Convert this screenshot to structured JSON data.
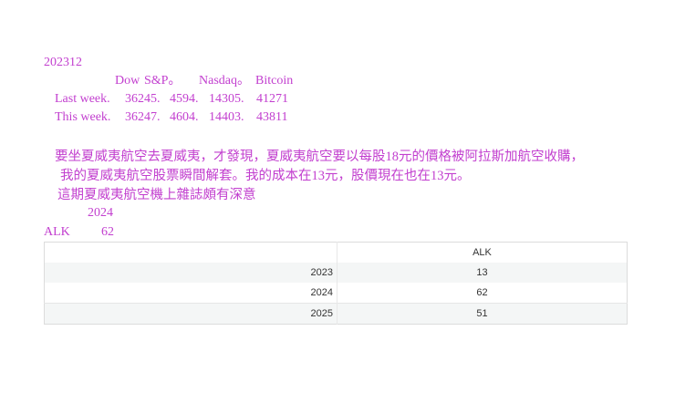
{
  "heading": "202312",
  "market": {
    "columns": [
      "Dow",
      "S&P。",
      "Nasdaq。",
      "Bitcoin"
    ],
    "rows": [
      {
        "label": "Last week.",
        "values": [
          "36245.",
          "4594.",
          "14305.",
          "41271"
        ]
      },
      {
        "label": "This week.",
        "values": [
          "36247.",
          "4604.",
          "14403.",
          "43811"
        ]
      }
    ]
  },
  "note": {
    "line1": "要坐夏威夷航空去夏威夷，才發現，夏威夷航空要以每股18元的價格被阿拉斯加航空收購，",
    "line2": "我的夏威夷航空股票瞬間解套。我的成本在13元，股價現在也在13元。",
    "line3": "這期夏威夷航空機上雜誌頗有深意"
  },
  "summary": {
    "year": "2024",
    "ticker": "ALK",
    "value": "62"
  },
  "table": {
    "header": [
      "",
      "ALK"
    ],
    "rows": [
      {
        "year": "2023",
        "value": "13"
      },
      {
        "year": "2024",
        "value": "62"
      },
      {
        "year": "2025",
        "value": "51"
      }
    ]
  }
}
